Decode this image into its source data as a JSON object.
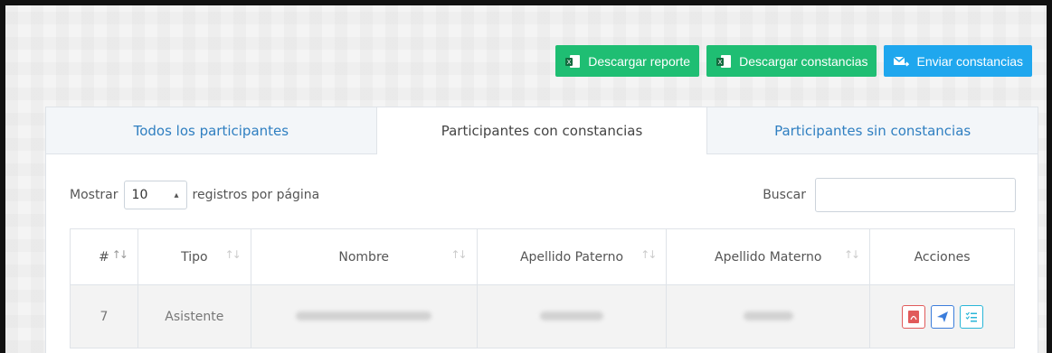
{
  "toolbar": {
    "download_report": "Descargar reporte",
    "download_certs": "Descargar constancias",
    "send_certs": "Enviar constancias"
  },
  "tabs": [
    {
      "label": "Todos los participantes",
      "active": false
    },
    {
      "label": "Participantes con constancias",
      "active": true
    },
    {
      "label": "Participantes sin constancias",
      "active": false
    }
  ],
  "controls": {
    "show_label": "Mostrar",
    "page_size": "10",
    "per_page_label": "registros por página",
    "search_label": "Buscar",
    "search_value": ""
  },
  "table": {
    "columns": [
      "#",
      "Tipo",
      "Nombre",
      "Apellido Paterno",
      "Apellido Materno",
      "Acciones"
    ],
    "rows": [
      {
        "num": "7",
        "tipo": "Asistente"
      }
    ]
  },
  "colors": {
    "green": "#1fbe73",
    "blue": "#1fa7ee",
    "link": "#2f7fc1"
  }
}
